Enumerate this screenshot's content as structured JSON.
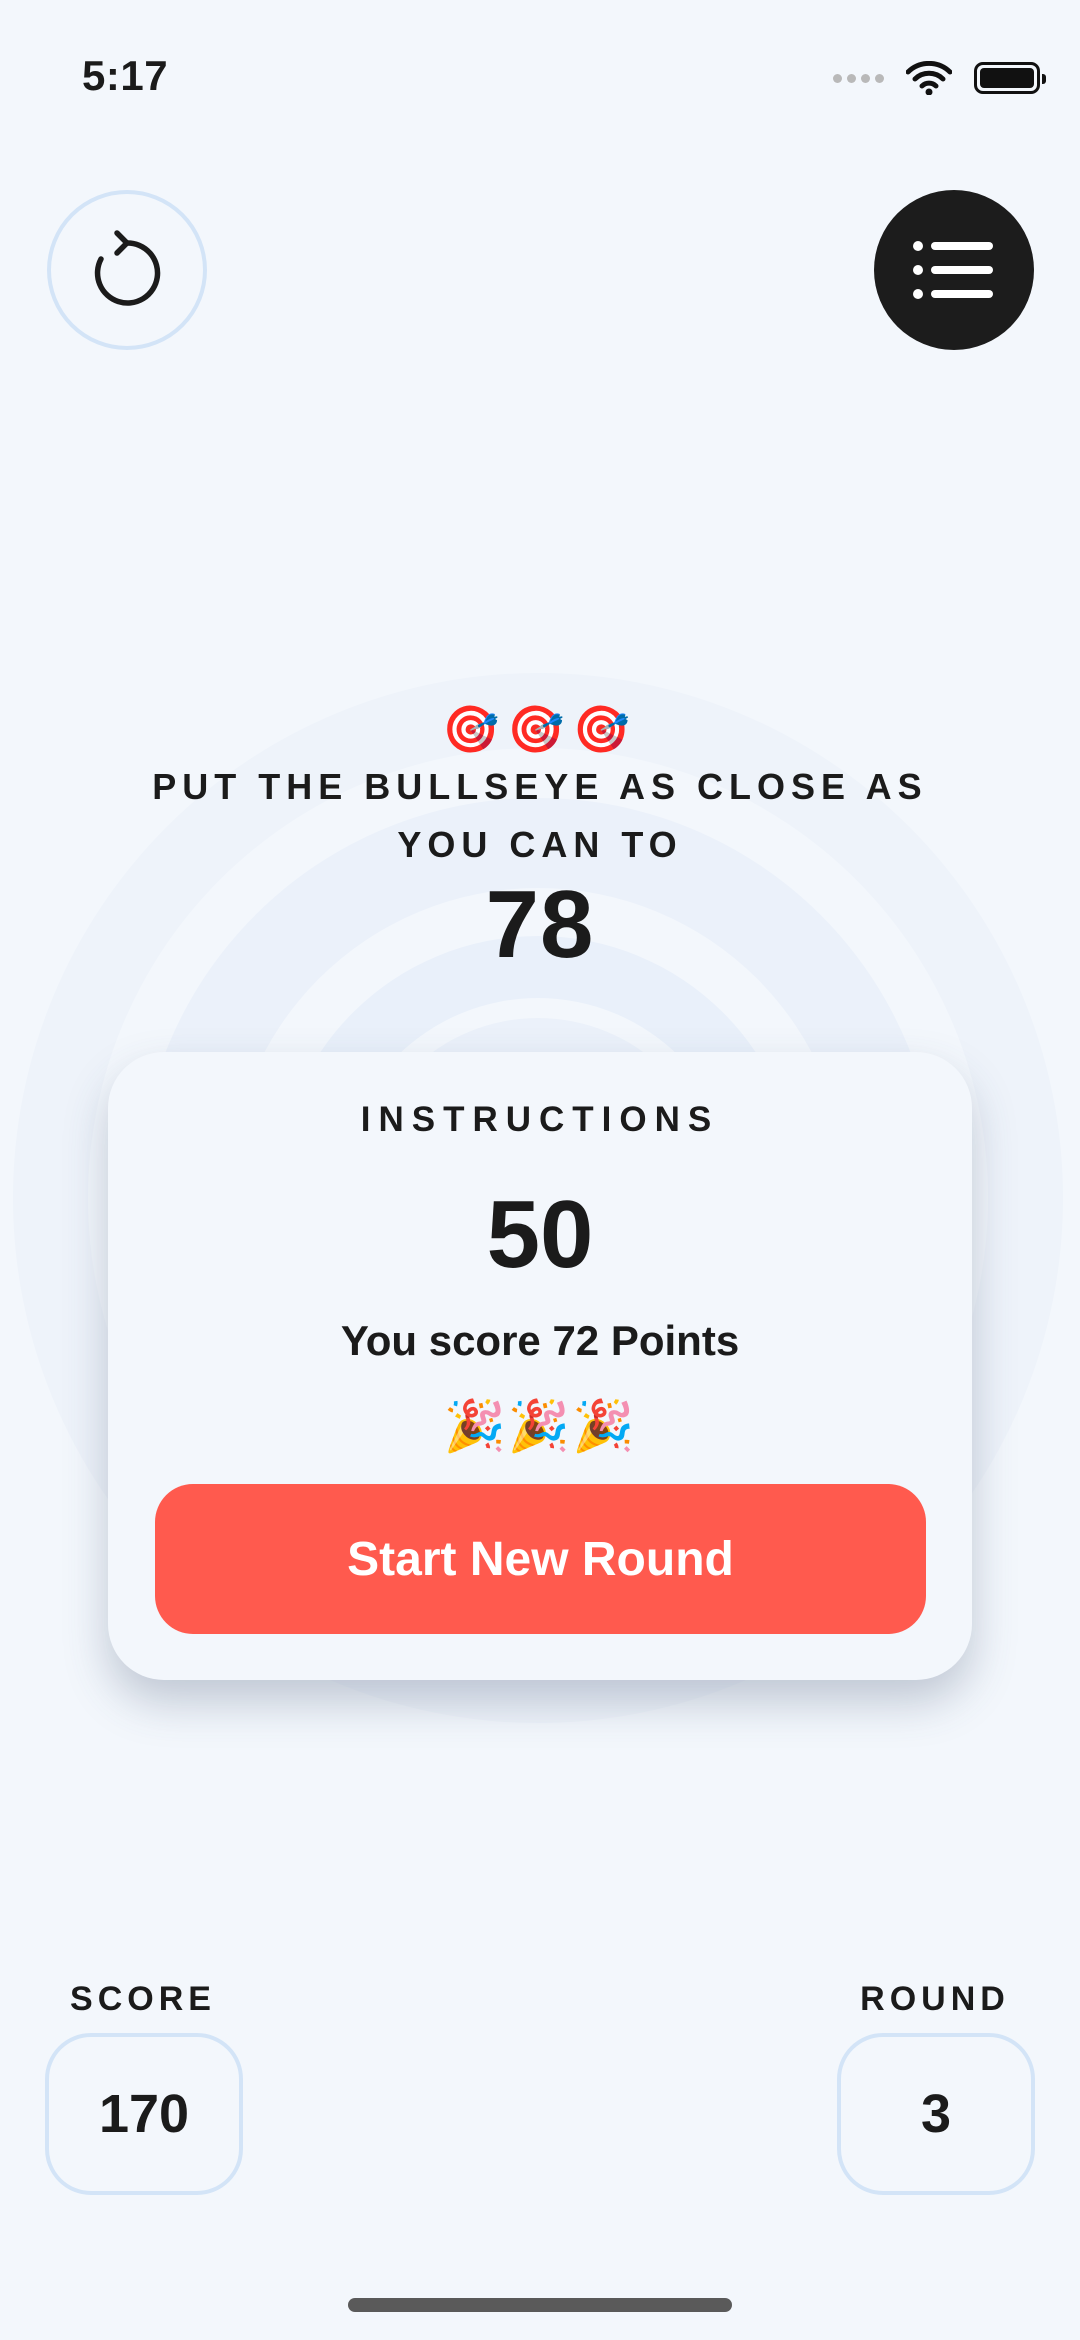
{
  "status_bar": {
    "time": "5:17"
  },
  "toolbar": {
    "restart_icon": "restart-icon",
    "menu_icon": "list-icon"
  },
  "header": {
    "emojis": "🎯🎯🎯",
    "instruction": "PUT THE BULLSEYE AS CLOSE AS YOU CAN TO",
    "target_value": "78"
  },
  "popup": {
    "title": "INSTRUCTIONS",
    "slider_value": "50",
    "message": "You score 72 Points",
    "emojis": "🎉🎉🎉",
    "button_label": "Start New Round"
  },
  "stats": {
    "score_label": "SCORE",
    "score_value": "170",
    "round_label": "ROUND",
    "round_value": "3"
  },
  "colors": {
    "background": "#F3F7FC",
    "accent": "#FF5A4E",
    "ring": "#E6EEF9",
    "border": "#D3E4F7",
    "dark_button": "#1C1C1C"
  }
}
